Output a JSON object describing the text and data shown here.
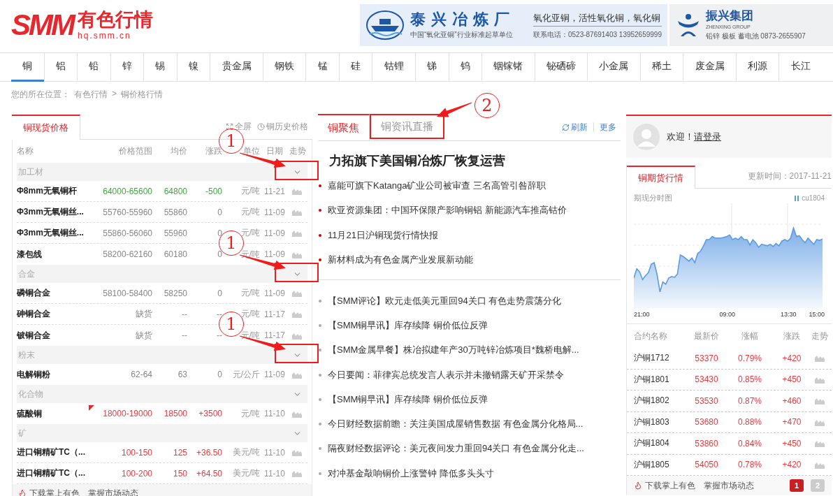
{
  "header": {
    "logo": {
      "brand": "SMM",
      "name": "有色行情",
      "url": "hq.smm.cn"
    },
    "ads": [
      {
        "kind": "smelter",
        "title": "泰兴冶炼厂",
        "subtitle": "中国“氧化亚铜”行业标准起草单位",
        "products": "氧化亚铜，活性氧化铜，氧化铜",
        "contact": "联系电话：0523-87691403 13952659999"
      },
      {
        "kind": "group",
        "title": "振兴集团",
        "subtitle": "ZHENXING GROUP",
        "contact": "铅锌 极板 蓄电池 0873-2655907"
      }
    ]
  },
  "nav": [
    {
      "label": "铜",
      "selected": true
    },
    {
      "label": "铝",
      "selected": false
    },
    {
      "label": "铅",
      "selected": false
    },
    {
      "label": "锌",
      "selected": false
    },
    {
      "label": "锡",
      "selected": false
    },
    {
      "label": "镍",
      "selected": false
    },
    {
      "label": "贵金属",
      "selected": false
    },
    {
      "label": "钢铁",
      "selected": false
    },
    {
      "label": "锰",
      "selected": false
    },
    {
      "label": "硅",
      "selected": false
    },
    {
      "label": "钴锂",
      "selected": false
    },
    {
      "label": "锑",
      "selected": false
    },
    {
      "label": "钨",
      "selected": false
    },
    {
      "label": "铟镓锗",
      "selected": false
    },
    {
      "label": "铋硒碲",
      "selected": false
    },
    {
      "label": "小金属",
      "selected": false
    },
    {
      "label": "稀土",
      "selected": false
    },
    {
      "label": "废金属",
      "selected": false
    },
    {
      "label": "利源",
      "selected": false
    },
    {
      "label": "长江",
      "selected": false
    }
  ],
  "breadcrumb": {
    "prefix": "您的所在位置：",
    "items": [
      "有色行情",
      "铜价格行情"
    ],
    "separator": ">"
  },
  "spot_prices": {
    "tab": "铜现货价格",
    "actions": [
      {
        "kind": "fullscreen",
        "label": "全屏"
      },
      {
        "kind": "history",
        "label": "铜历史价格"
      }
    ],
    "columns": [
      "名称",
      "价格范围",
      "均价",
      "涨跌",
      "单位",
      "日期",
      "走势"
    ],
    "groups": [
      {
        "name": "加工材",
        "callout": "1",
        "rows": [
          {
            "name": "Φ8mm无氧铜杆",
            "range": "64000-65600",
            "avg": "64800",
            "change": "-500",
            "unit": "元/吨",
            "date": "11-21",
            "color": "#3da83d",
            "flag": false
          },
          {
            "name": "Φ3mm无氧铜丝...",
            "range": "55760-55960",
            "avg": "55860",
            "change": "0",
            "unit": "元/吨",
            "date": "11-09",
            "color": "#888888",
            "flag": false
          },
          {
            "name": "Φ3mm无氧铜丝...",
            "range": "55860-56060",
            "avg": "55960",
            "change": "0",
            "unit": "元/吨",
            "date": "11-09",
            "color": "#888888",
            "flag": false
          },
          {
            "name": "漆包线",
            "range": "58200-62160",
            "avg": "60180",
            "change": "0",
            "unit": "元/吨",
            "date": "11-09",
            "color": "#888888",
            "flag": false
          }
        ]
      },
      {
        "name": "合金",
        "callout": "1",
        "rows": [
          {
            "name": "磷铜合金",
            "range": "58100-58400",
            "avg": "58250",
            "change": "0",
            "unit": "元/吨",
            "date": "11-09",
            "color": "#888888",
            "flag": false
          },
          {
            "name": "砷铜合金",
            "range": "缺货",
            "avg": "--",
            "change": "--",
            "unit": "元/吨",
            "date": "11-17",
            "color": "#888888",
            "flag": false
          },
          {
            "name": "铍铜合金",
            "range": "缺货",
            "avg": "--",
            "change": "--",
            "unit": "元/吨",
            "date": "11-17",
            "color": "#888888",
            "flag": false
          }
        ]
      },
      {
        "name": "粉末",
        "callout": "1",
        "rows": [
          {
            "name": "电解铜粉",
            "range": "62-64",
            "avg": "63",
            "change": "0",
            "unit": "元/公斤",
            "date": "11-09",
            "color": "#888888",
            "flag": false
          }
        ]
      },
      {
        "name": "化合物",
        "rows": [
          {
            "name": "硫酸铜",
            "range": "18000-19000",
            "avg": "18500",
            "change": "+3500",
            "unit": "元/吨",
            "date": "11-10",
            "color": "#f0373c",
            "flag": true
          }
        ]
      },
      {
        "name": "矿",
        "rows": [
          {
            "name": "进口铜精矿TC（...",
            "range": "100-150",
            "avg": "125",
            "change": "+36.50",
            "unit": "美元/吨",
            "date": "11-10",
            "color": "#f0373c",
            "flag": false
          },
          {
            "name": "进口铜精矿TC（...",
            "range": "100-200",
            "avg": "150",
            "change": "+64.50",
            "unit": "美元/吨",
            "date": "11-10",
            "color": "#f0373c",
            "flag": false
          }
        ]
      }
    ],
    "footer": "下载掌上有色　掌握市场动态"
  },
  "news": {
    "tabs": [
      {
        "label": "铜聚焦",
        "selected": true
      },
      {
        "label": "铜资讯直播",
        "selected": false,
        "callout": "2"
      }
    ],
    "actions": [
      {
        "kind": "refresh",
        "label": "刷新"
      },
      {
        "kind": "more",
        "label": "更多"
      }
    ],
    "headline": "力拓旗下美国铜冶炼厂恢复运营",
    "focus_items": [
      "嘉能可旗下Katanga矿业公司被审查 三名高管引咎辞职",
      "欧亚资源集团：中国环保限产影响铜铝 新能源汽车推高钴价",
      "11月21日沪铜现货行情快报",
      "新材料成为有色金属产业发展新动能"
    ],
    "items": [
      "【SMM评论】欧元走低美元重回94关口 有色走势震荡分化",
      "【SMM铜早讯】库存续降 铜价低位反弹",
      "【SMM金属早餐】株冶拟建年产30万吨锌冶炼项目*魏桥电解...",
      "今日要闻：菲律宾总统发言人表示并未撤销露天矿开采禁令",
      "【SMM铜早讯】库存续降 铜价低位反弹",
      "今日财经数据前瞻：关注美国成屋销售数据 有色金属分化格局...",
      "隔夜财经数据评论：美元夜间发力重回94关口 有色金属分化走...",
      "对冲基金敲响铜价上涨警钟 降低多头头寸"
    ]
  },
  "user": {
    "greeting": "欢迎！",
    "login": "请登录"
  },
  "futures": {
    "tab": "铜期货行情",
    "updated": "更新时间：2017-11-21",
    "chart": {
      "title": "期现分时图",
      "legend": "cu1804",
      "times": [
        "21:00",
        "09:00",
        "13:30",
        "15:00"
      ]
    },
    "columns": [
      "合约名称",
      "最新价",
      "涨幅",
      "涨跌",
      "走势"
    ],
    "rows": [
      {
        "name": "沪铜1712",
        "price": "53370",
        "pct": "0.79%",
        "change": "+420"
      },
      {
        "name": "沪铜1801",
        "price": "53430",
        "pct": "0.85%",
        "change": "+450"
      },
      {
        "name": "沪铜1802",
        "price": "53530",
        "pct": "0.87%",
        "change": "+460"
      },
      {
        "name": "沪铜1803",
        "price": "53680",
        "pct": "0.88%",
        "change": "+470"
      },
      {
        "name": "沪铜1804",
        "price": "53860",
        "pct": "0.84%",
        "change": "+450"
      },
      {
        "name": "沪铜1805",
        "price": "54050",
        "pct": "0.78%",
        "change": "+420"
      }
    ],
    "footer": "下载掌上有色　掌握市场动态",
    "pages": [
      {
        "label": "1",
        "selected": true
      },
      {
        "label": "2",
        "selected": false
      }
    ]
  }
}
